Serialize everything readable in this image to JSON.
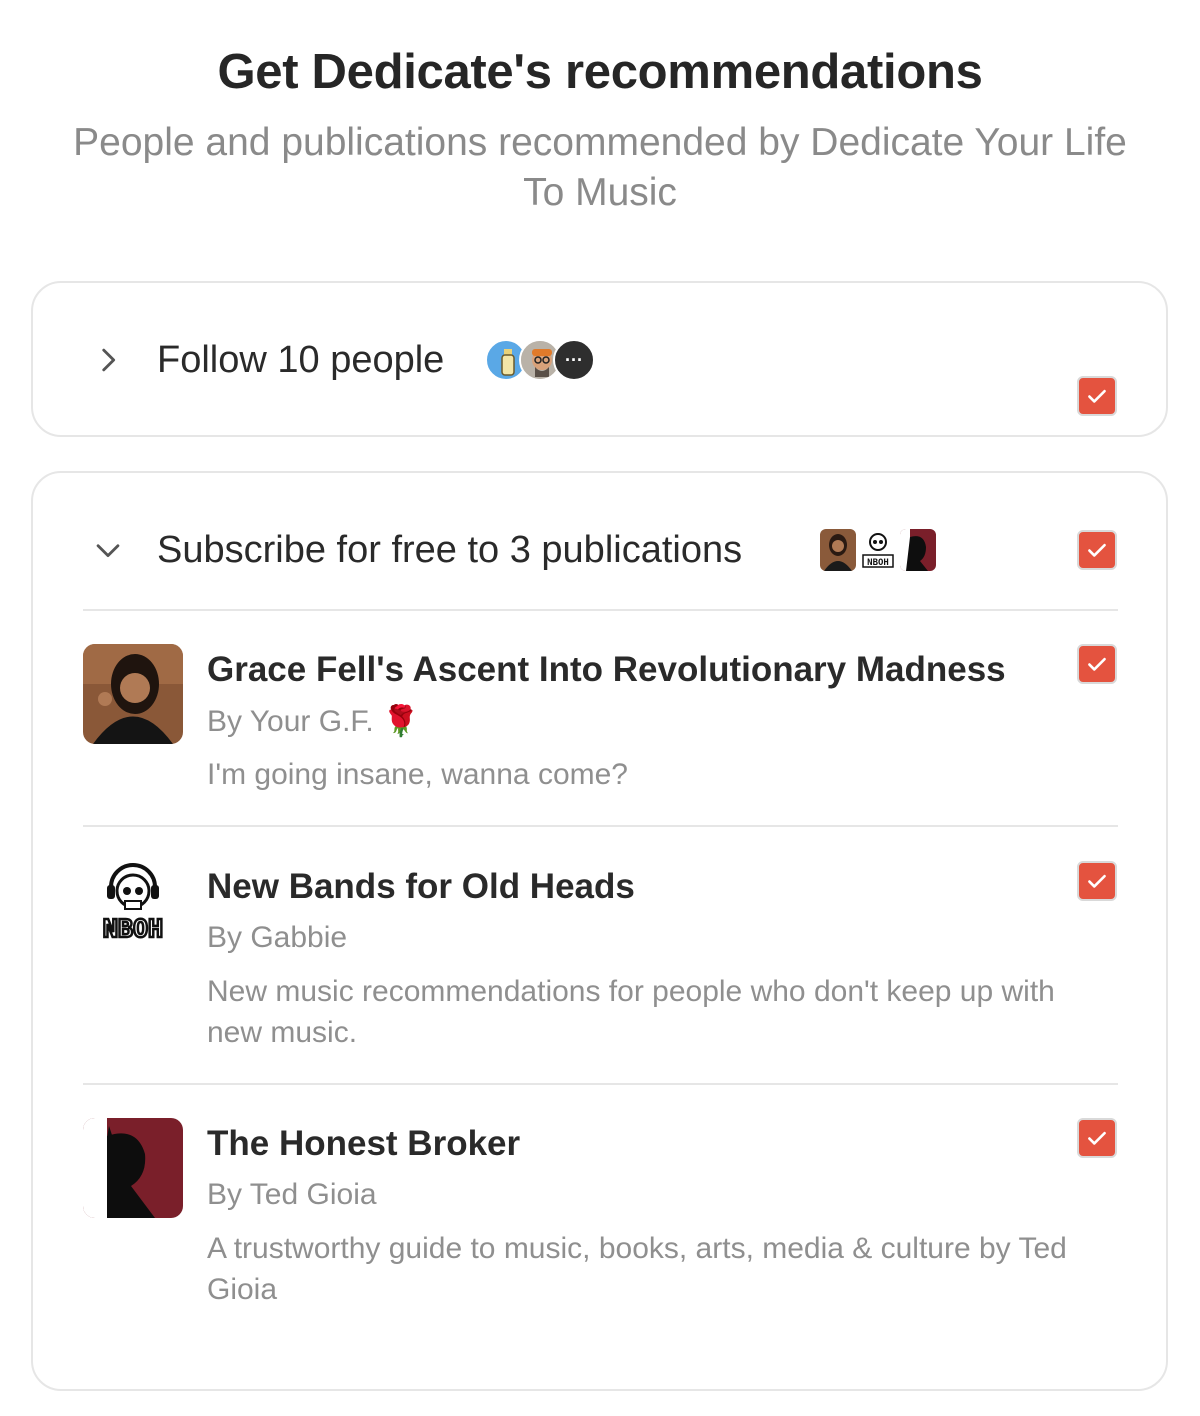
{
  "header": {
    "title": "Get Dedicate's recommendations",
    "subtitle": "People and publications recommended by Dedicate Your Life To Music"
  },
  "people_section": {
    "label": "Follow 10 people",
    "expanded": false,
    "checked": true,
    "more_glyph": "···"
  },
  "publications_section": {
    "label": "Subscribe for free to 3 publications",
    "expanded": true,
    "checked": true,
    "items": [
      {
        "name": "Grace Fell's Ascent Into Revolutionary Madness",
        "author": "By Your G.F. 🌹",
        "description": "I'm going insane, wanna come?",
        "checked": true
      },
      {
        "name": "New Bands for Old Heads",
        "author": "By Gabbie",
        "description": "New music recommendations for people who don't keep up with new music.",
        "checked": true,
        "logo_text": "NBOH"
      },
      {
        "name": "The Honest Broker",
        "author": "By Ted Gioia",
        "description": "A trustworthy guide to music, books, arts, media & culture by Ted Gioia",
        "checked": true
      }
    ]
  },
  "colors": {
    "checkbox": "#e4533f",
    "border": "#e6e6e6",
    "muted_text": "#8f8f8f"
  }
}
